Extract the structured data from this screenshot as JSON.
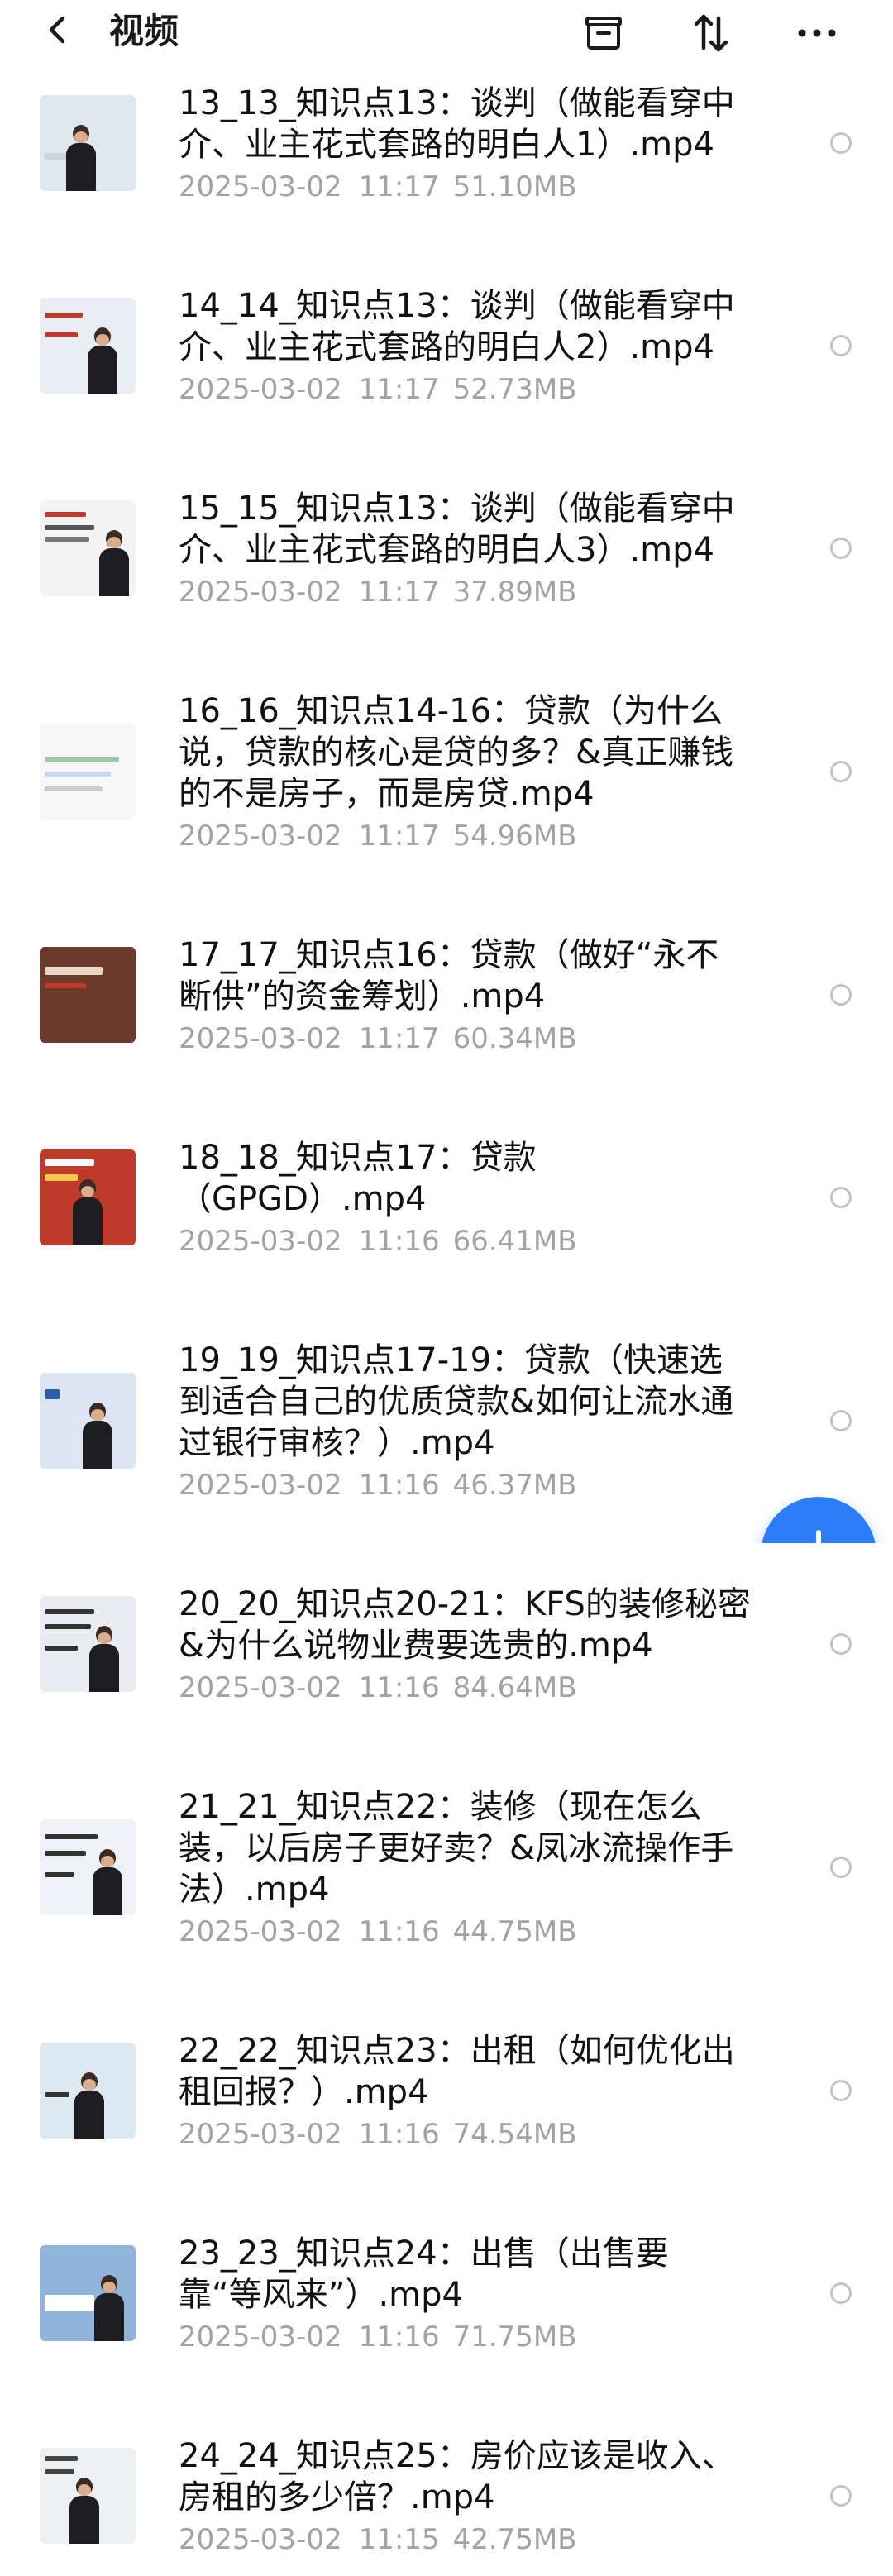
{
  "header": {
    "title": "视频",
    "icons": [
      "back-icon",
      "archive-icon",
      "sort-icon",
      "more-icon"
    ]
  },
  "files": [
    {
      "name": "13_13_知识点13：谈判（做能看穿中\n介、业主花式套路的明白人1）.mp4",
      "date": "2025-03-02",
      "time": "11:17",
      "size": "51.10MB"
    },
    {
      "name": "14_14_知识点13：谈判（做能看穿中\n介、业主花式套路的明白人2）.mp4",
      "date": "2025-03-02",
      "time": "11:17",
      "size": "52.73MB"
    },
    {
      "name": "15_15_知识点13：谈判（做能看穿中\n介、业主花式套路的明白人3）.mp4",
      "date": "2025-03-02",
      "time": "11:17",
      "size": "37.89MB"
    },
    {
      "name": "16_16_知识点14-16：贷款（为什么\n说，贷款的核心是贷的多？&真正赚钱\n的不是房子，而是房贷.mp4",
      "date": "2025-03-02",
      "time": "11:17",
      "size": "54.96MB"
    },
    {
      "name": "17_17_知识点16：贷款（做好“永不\n断供”的资金筹划）.mp4",
      "date": "2025-03-02",
      "time": "11:17",
      "size": "60.34MB"
    },
    {
      "name": "18_18_知识点17：贷款\n（GPGD）.mp4",
      "date": "2025-03-02",
      "time": "11:16",
      "size": "66.41MB"
    },
    {
      "name": "19_19_知识点17-19：贷款（快速选\n到适合自己的优质贷款&如何让流水通\n过银行审核？）.mp4",
      "date": "2025-03-02",
      "time": "11:16",
      "size": "46.37MB"
    },
    {
      "name": "20_20_知识点20-21：KFS的装修秘密\n&为什么说物业费要选贵的.mp4",
      "date": "2025-03-02",
      "time": "11:16",
      "size": "84.64MB"
    },
    {
      "name": "21_21_知识点22：装修（现在怎么\n装，以后房子更好卖？&凤冰流操作手\n法）.mp4",
      "date": "2025-03-02",
      "time": "11:16",
      "size": "44.75MB"
    },
    {
      "name": "22_22_知识点23：出租（如何优化出\n租回报？）.mp4",
      "date": "2025-03-02",
      "time": "11:16",
      "size": "74.54MB"
    },
    {
      "name": "23_23_知识点24：出售（出售要\n靠“等风来”）.mp4",
      "date": "2025-03-02",
      "time": "11:16",
      "size": "71.75MB"
    },
    {
      "name": "24_24_知识点25：房价应该是收入、\n房租的多少倍？.mp4",
      "date": "2025-03-02",
      "time": "11:15",
      "size": "42.75MB"
    }
  ],
  "fab": {
    "icon": "plus-icon"
  },
  "colors": {
    "accent": "#2c7ef8",
    "meta": "#a3a3a3",
    "radio": "#c4c4c4"
  }
}
